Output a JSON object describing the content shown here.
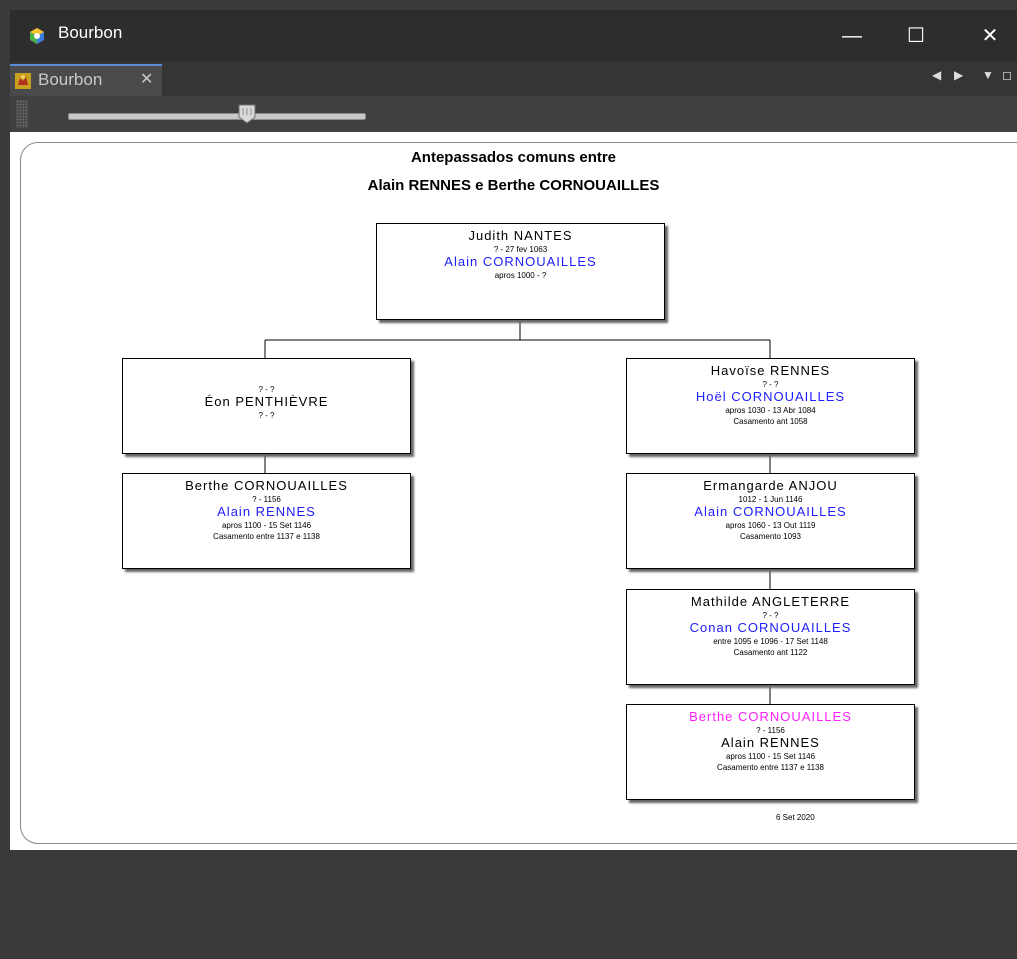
{
  "window": {
    "title": "Bourbon",
    "minimize": "—",
    "maximize": "☐",
    "close": "✕"
  },
  "tab": {
    "label": "Bourbon",
    "close": "✕"
  },
  "toolbar": {
    "zoom_level": 0.6
  },
  "chart": {
    "title_line1": "Antepassados comuns entre",
    "title_line2": "Alain RENNES e Berthe CORNOUAILLES",
    "footer_date": "6 Set 2020",
    "root": {
      "name": "Judith NANTES",
      "dates": "? - 27 fev 1063",
      "spouse": "Alain CORNOUAILLES",
      "spouse_dates": "apros 1000 - ?"
    },
    "left": [
      {
        "pre": "? - ?",
        "name": "Éon PENTHIÈVRE",
        "dates": "? - ?"
      },
      {
        "name": "Berthe CORNOUAILLES",
        "dates": "? - 1156",
        "spouse": "Alain RENNES",
        "spouse_dates": "apros 1100 - 15 Set 1146",
        "marriage": "Casamento entre 1137 e 1138"
      }
    ],
    "right": [
      {
        "name": "Havoïse RENNES",
        "dates": "? - ?",
        "spouse": "Hoël CORNOUAILLES",
        "spouse_dates": "apros 1030 - 13 Abr 1084",
        "marriage": "Casamento ant 1058"
      },
      {
        "name": "Ermangarde ANJOU",
        "dates": "1012 - 1 Jun 1146",
        "spouse": "Alain CORNOUAILLES",
        "spouse_dates": "apros 1060 - 13 Out 1119",
        "marriage": "Casamento 1093"
      },
      {
        "name": "Mathilde ANGLETERRE",
        "dates": "? - ?",
        "spouse": "Conan CORNOUAILLES",
        "spouse_dates": "entre 1095 e 1096 - 17 Set 1148",
        "marriage": "Casamento ant 1122"
      },
      {
        "name": "Berthe CORNOUAILLES",
        "dates": "? - 1156",
        "spouse": "Alain RENNES",
        "spouse_dates": "apros 1100 - 15 Set 1146",
        "marriage": "Casamento entre 1137 e 1138"
      }
    ]
  },
  "colors": {
    "spouse": "#2020ff",
    "highlight": "#ff20ff",
    "accent": "#5a8bd6"
  },
  "icons": {
    "app": "hexagon-logo-icon",
    "tab": "lion-crest-icon"
  }
}
